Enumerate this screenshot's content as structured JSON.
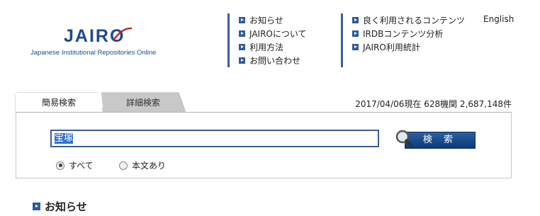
{
  "logo": {
    "name": "JAIRO",
    "subtitle": "Japanese Institutional Repositories Online"
  },
  "nav": {
    "col1": [
      {
        "label": "お知らせ"
      },
      {
        "label": "JAIROについて"
      },
      {
        "label": "利用方法"
      },
      {
        "label": "お問い合わせ"
      }
    ],
    "col2": [
      {
        "label": "良く利用されるコンテンツ"
      },
      {
        "label": "IRDBコンテンツ分析"
      },
      {
        "label": "JAIRO利用統計"
      }
    ],
    "english": "English"
  },
  "tabs": {
    "simple": "簡易検索",
    "detail": "詳細検索"
  },
  "stats": "2017/04/06現在  628機関  2,687,148件",
  "search": {
    "query": "宝塚",
    "button_label": "検 索"
  },
  "filters": [
    {
      "label": "すべて",
      "selected": true
    },
    {
      "label": "本文あり",
      "selected": false
    }
  ],
  "news": {
    "heading": "お知らせ"
  },
  "colors": {
    "brand": "#1d4a8f",
    "accent": "#2e5b9c",
    "button": "#0b3a78"
  }
}
